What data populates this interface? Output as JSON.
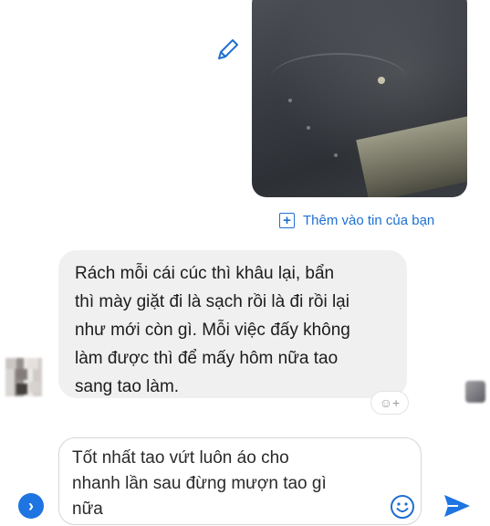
{
  "attachment": {
    "add_to_story_label": "Thêm vào tin của bạn",
    "add_icon": "plus-square-icon",
    "edit_icon": "pencil-icon"
  },
  "incoming_message": {
    "lines": [
      "Rách mỗi cái cúc thì khâu lại, bẩn",
      "thì mày giặt đi là sạch rồi là đi rồi lại",
      "như mới còn gì. Mỗi việc đấy không",
      "làm được thì để mấy hôm nữa tao",
      "sang tao làm."
    ],
    "reaction_button_label": "☺+"
  },
  "composer": {
    "lines": [
      "Tốt nhất tao vứt luôn áo cho",
      "nhanh lần sau đừng mượn tao gì",
      "nữa"
    ],
    "emoji_icon": "smiley-icon",
    "send_icon": "send-arrow-icon",
    "expand_icon": "chevron-right-icon",
    "expand_label": "›"
  },
  "colors": {
    "accent": "#1e6fd0",
    "incoming_bubble": "#f0f0f0",
    "text": "#1c1c1c"
  }
}
